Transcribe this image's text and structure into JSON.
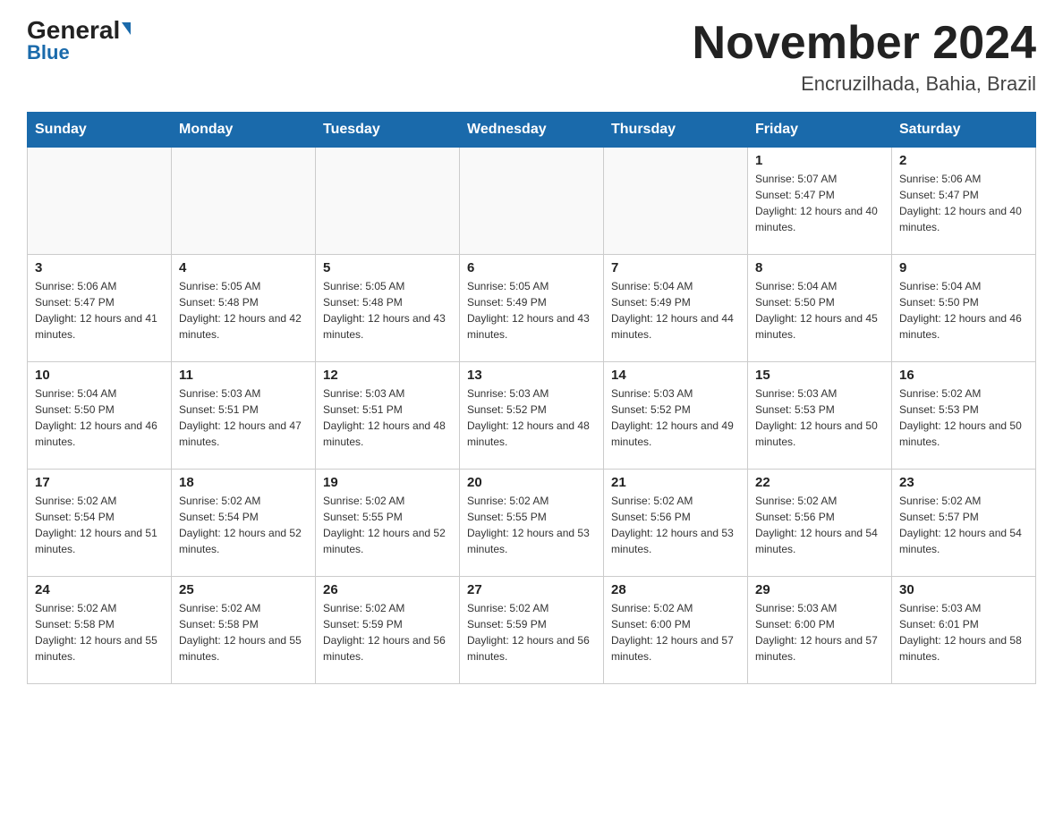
{
  "header": {
    "logo_general": "General",
    "logo_blue": "Blue",
    "month_year": "November 2024",
    "location": "Encruzilhada, Bahia, Brazil"
  },
  "days_of_week": [
    "Sunday",
    "Monday",
    "Tuesday",
    "Wednesday",
    "Thursday",
    "Friday",
    "Saturday"
  ],
  "weeks": [
    [
      {
        "day": "",
        "info": ""
      },
      {
        "day": "",
        "info": ""
      },
      {
        "day": "",
        "info": ""
      },
      {
        "day": "",
        "info": ""
      },
      {
        "day": "",
        "info": ""
      },
      {
        "day": "1",
        "info": "Sunrise: 5:07 AM\nSunset: 5:47 PM\nDaylight: 12 hours and 40 minutes."
      },
      {
        "day": "2",
        "info": "Sunrise: 5:06 AM\nSunset: 5:47 PM\nDaylight: 12 hours and 40 minutes."
      }
    ],
    [
      {
        "day": "3",
        "info": "Sunrise: 5:06 AM\nSunset: 5:47 PM\nDaylight: 12 hours and 41 minutes."
      },
      {
        "day": "4",
        "info": "Sunrise: 5:05 AM\nSunset: 5:48 PM\nDaylight: 12 hours and 42 minutes."
      },
      {
        "day": "5",
        "info": "Sunrise: 5:05 AM\nSunset: 5:48 PM\nDaylight: 12 hours and 43 minutes."
      },
      {
        "day": "6",
        "info": "Sunrise: 5:05 AM\nSunset: 5:49 PM\nDaylight: 12 hours and 43 minutes."
      },
      {
        "day": "7",
        "info": "Sunrise: 5:04 AM\nSunset: 5:49 PM\nDaylight: 12 hours and 44 minutes."
      },
      {
        "day": "8",
        "info": "Sunrise: 5:04 AM\nSunset: 5:50 PM\nDaylight: 12 hours and 45 minutes."
      },
      {
        "day": "9",
        "info": "Sunrise: 5:04 AM\nSunset: 5:50 PM\nDaylight: 12 hours and 46 minutes."
      }
    ],
    [
      {
        "day": "10",
        "info": "Sunrise: 5:04 AM\nSunset: 5:50 PM\nDaylight: 12 hours and 46 minutes."
      },
      {
        "day": "11",
        "info": "Sunrise: 5:03 AM\nSunset: 5:51 PM\nDaylight: 12 hours and 47 minutes."
      },
      {
        "day": "12",
        "info": "Sunrise: 5:03 AM\nSunset: 5:51 PM\nDaylight: 12 hours and 48 minutes."
      },
      {
        "day": "13",
        "info": "Sunrise: 5:03 AM\nSunset: 5:52 PM\nDaylight: 12 hours and 48 minutes."
      },
      {
        "day": "14",
        "info": "Sunrise: 5:03 AM\nSunset: 5:52 PM\nDaylight: 12 hours and 49 minutes."
      },
      {
        "day": "15",
        "info": "Sunrise: 5:03 AM\nSunset: 5:53 PM\nDaylight: 12 hours and 50 minutes."
      },
      {
        "day": "16",
        "info": "Sunrise: 5:02 AM\nSunset: 5:53 PM\nDaylight: 12 hours and 50 minutes."
      }
    ],
    [
      {
        "day": "17",
        "info": "Sunrise: 5:02 AM\nSunset: 5:54 PM\nDaylight: 12 hours and 51 minutes."
      },
      {
        "day": "18",
        "info": "Sunrise: 5:02 AM\nSunset: 5:54 PM\nDaylight: 12 hours and 52 minutes."
      },
      {
        "day": "19",
        "info": "Sunrise: 5:02 AM\nSunset: 5:55 PM\nDaylight: 12 hours and 52 minutes."
      },
      {
        "day": "20",
        "info": "Sunrise: 5:02 AM\nSunset: 5:55 PM\nDaylight: 12 hours and 53 minutes."
      },
      {
        "day": "21",
        "info": "Sunrise: 5:02 AM\nSunset: 5:56 PM\nDaylight: 12 hours and 53 minutes."
      },
      {
        "day": "22",
        "info": "Sunrise: 5:02 AM\nSunset: 5:56 PM\nDaylight: 12 hours and 54 minutes."
      },
      {
        "day": "23",
        "info": "Sunrise: 5:02 AM\nSunset: 5:57 PM\nDaylight: 12 hours and 54 minutes."
      }
    ],
    [
      {
        "day": "24",
        "info": "Sunrise: 5:02 AM\nSunset: 5:58 PM\nDaylight: 12 hours and 55 minutes."
      },
      {
        "day": "25",
        "info": "Sunrise: 5:02 AM\nSunset: 5:58 PM\nDaylight: 12 hours and 55 minutes."
      },
      {
        "day": "26",
        "info": "Sunrise: 5:02 AM\nSunset: 5:59 PM\nDaylight: 12 hours and 56 minutes."
      },
      {
        "day": "27",
        "info": "Sunrise: 5:02 AM\nSunset: 5:59 PM\nDaylight: 12 hours and 56 minutes."
      },
      {
        "day": "28",
        "info": "Sunrise: 5:02 AM\nSunset: 6:00 PM\nDaylight: 12 hours and 57 minutes."
      },
      {
        "day": "29",
        "info": "Sunrise: 5:03 AM\nSunset: 6:00 PM\nDaylight: 12 hours and 57 minutes."
      },
      {
        "day": "30",
        "info": "Sunrise: 5:03 AM\nSunset: 6:01 PM\nDaylight: 12 hours and 58 minutes."
      }
    ]
  ]
}
